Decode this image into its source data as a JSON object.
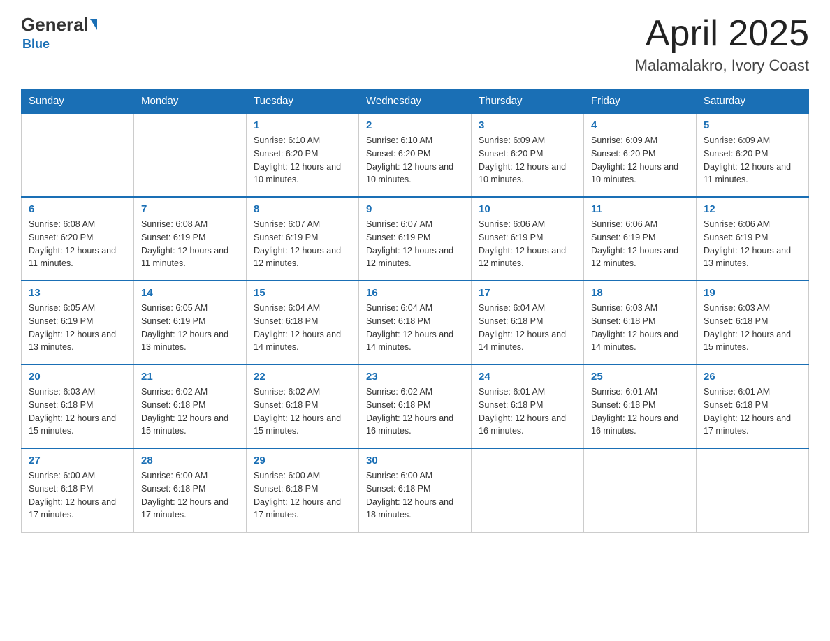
{
  "header": {
    "logo_text": "General",
    "logo_blue": "Blue",
    "month": "April 2025",
    "location": "Malamalakro, Ivory Coast"
  },
  "days_of_week": [
    "Sunday",
    "Monday",
    "Tuesday",
    "Wednesday",
    "Thursday",
    "Friday",
    "Saturday"
  ],
  "weeks": [
    [
      {
        "day": "",
        "sunrise": "",
        "sunset": "",
        "daylight": ""
      },
      {
        "day": "",
        "sunrise": "",
        "sunset": "",
        "daylight": ""
      },
      {
        "day": "1",
        "sunrise": "Sunrise: 6:10 AM",
        "sunset": "Sunset: 6:20 PM",
        "daylight": "Daylight: 12 hours and 10 minutes."
      },
      {
        "day": "2",
        "sunrise": "Sunrise: 6:10 AM",
        "sunset": "Sunset: 6:20 PM",
        "daylight": "Daylight: 12 hours and 10 minutes."
      },
      {
        "day": "3",
        "sunrise": "Sunrise: 6:09 AM",
        "sunset": "Sunset: 6:20 PM",
        "daylight": "Daylight: 12 hours and 10 minutes."
      },
      {
        "day": "4",
        "sunrise": "Sunrise: 6:09 AM",
        "sunset": "Sunset: 6:20 PM",
        "daylight": "Daylight: 12 hours and 10 minutes."
      },
      {
        "day": "5",
        "sunrise": "Sunrise: 6:09 AM",
        "sunset": "Sunset: 6:20 PM",
        "daylight": "Daylight: 12 hours and 11 minutes."
      }
    ],
    [
      {
        "day": "6",
        "sunrise": "Sunrise: 6:08 AM",
        "sunset": "Sunset: 6:20 PM",
        "daylight": "Daylight: 12 hours and 11 minutes."
      },
      {
        "day": "7",
        "sunrise": "Sunrise: 6:08 AM",
        "sunset": "Sunset: 6:19 PM",
        "daylight": "Daylight: 12 hours and 11 minutes."
      },
      {
        "day": "8",
        "sunrise": "Sunrise: 6:07 AM",
        "sunset": "Sunset: 6:19 PM",
        "daylight": "Daylight: 12 hours and 12 minutes."
      },
      {
        "day": "9",
        "sunrise": "Sunrise: 6:07 AM",
        "sunset": "Sunset: 6:19 PM",
        "daylight": "Daylight: 12 hours and 12 minutes."
      },
      {
        "day": "10",
        "sunrise": "Sunrise: 6:06 AM",
        "sunset": "Sunset: 6:19 PM",
        "daylight": "Daylight: 12 hours and 12 minutes."
      },
      {
        "day": "11",
        "sunrise": "Sunrise: 6:06 AM",
        "sunset": "Sunset: 6:19 PM",
        "daylight": "Daylight: 12 hours and 12 minutes."
      },
      {
        "day": "12",
        "sunrise": "Sunrise: 6:06 AM",
        "sunset": "Sunset: 6:19 PM",
        "daylight": "Daylight: 12 hours and 13 minutes."
      }
    ],
    [
      {
        "day": "13",
        "sunrise": "Sunrise: 6:05 AM",
        "sunset": "Sunset: 6:19 PM",
        "daylight": "Daylight: 12 hours and 13 minutes."
      },
      {
        "day": "14",
        "sunrise": "Sunrise: 6:05 AM",
        "sunset": "Sunset: 6:19 PM",
        "daylight": "Daylight: 12 hours and 13 minutes."
      },
      {
        "day": "15",
        "sunrise": "Sunrise: 6:04 AM",
        "sunset": "Sunset: 6:18 PM",
        "daylight": "Daylight: 12 hours and 14 minutes."
      },
      {
        "day": "16",
        "sunrise": "Sunrise: 6:04 AM",
        "sunset": "Sunset: 6:18 PM",
        "daylight": "Daylight: 12 hours and 14 minutes."
      },
      {
        "day": "17",
        "sunrise": "Sunrise: 6:04 AM",
        "sunset": "Sunset: 6:18 PM",
        "daylight": "Daylight: 12 hours and 14 minutes."
      },
      {
        "day": "18",
        "sunrise": "Sunrise: 6:03 AM",
        "sunset": "Sunset: 6:18 PM",
        "daylight": "Daylight: 12 hours and 14 minutes."
      },
      {
        "day": "19",
        "sunrise": "Sunrise: 6:03 AM",
        "sunset": "Sunset: 6:18 PM",
        "daylight": "Daylight: 12 hours and 15 minutes."
      }
    ],
    [
      {
        "day": "20",
        "sunrise": "Sunrise: 6:03 AM",
        "sunset": "Sunset: 6:18 PM",
        "daylight": "Daylight: 12 hours and 15 minutes."
      },
      {
        "day": "21",
        "sunrise": "Sunrise: 6:02 AM",
        "sunset": "Sunset: 6:18 PM",
        "daylight": "Daylight: 12 hours and 15 minutes."
      },
      {
        "day": "22",
        "sunrise": "Sunrise: 6:02 AM",
        "sunset": "Sunset: 6:18 PM",
        "daylight": "Daylight: 12 hours and 15 minutes."
      },
      {
        "day": "23",
        "sunrise": "Sunrise: 6:02 AM",
        "sunset": "Sunset: 6:18 PM",
        "daylight": "Daylight: 12 hours and 16 minutes."
      },
      {
        "day": "24",
        "sunrise": "Sunrise: 6:01 AM",
        "sunset": "Sunset: 6:18 PM",
        "daylight": "Daylight: 12 hours and 16 minutes."
      },
      {
        "day": "25",
        "sunrise": "Sunrise: 6:01 AM",
        "sunset": "Sunset: 6:18 PM",
        "daylight": "Daylight: 12 hours and 16 minutes."
      },
      {
        "day": "26",
        "sunrise": "Sunrise: 6:01 AM",
        "sunset": "Sunset: 6:18 PM",
        "daylight": "Daylight: 12 hours and 17 minutes."
      }
    ],
    [
      {
        "day": "27",
        "sunrise": "Sunrise: 6:00 AM",
        "sunset": "Sunset: 6:18 PM",
        "daylight": "Daylight: 12 hours and 17 minutes."
      },
      {
        "day": "28",
        "sunrise": "Sunrise: 6:00 AM",
        "sunset": "Sunset: 6:18 PM",
        "daylight": "Daylight: 12 hours and 17 minutes."
      },
      {
        "day": "29",
        "sunrise": "Sunrise: 6:00 AM",
        "sunset": "Sunset: 6:18 PM",
        "daylight": "Daylight: 12 hours and 17 minutes."
      },
      {
        "day": "30",
        "sunrise": "Sunrise: 6:00 AM",
        "sunset": "Sunset: 6:18 PM",
        "daylight": "Daylight: 12 hours and 18 minutes."
      },
      {
        "day": "",
        "sunrise": "",
        "sunset": "",
        "daylight": ""
      },
      {
        "day": "",
        "sunrise": "",
        "sunset": "",
        "daylight": ""
      },
      {
        "day": "",
        "sunrise": "",
        "sunset": "",
        "daylight": ""
      }
    ]
  ]
}
